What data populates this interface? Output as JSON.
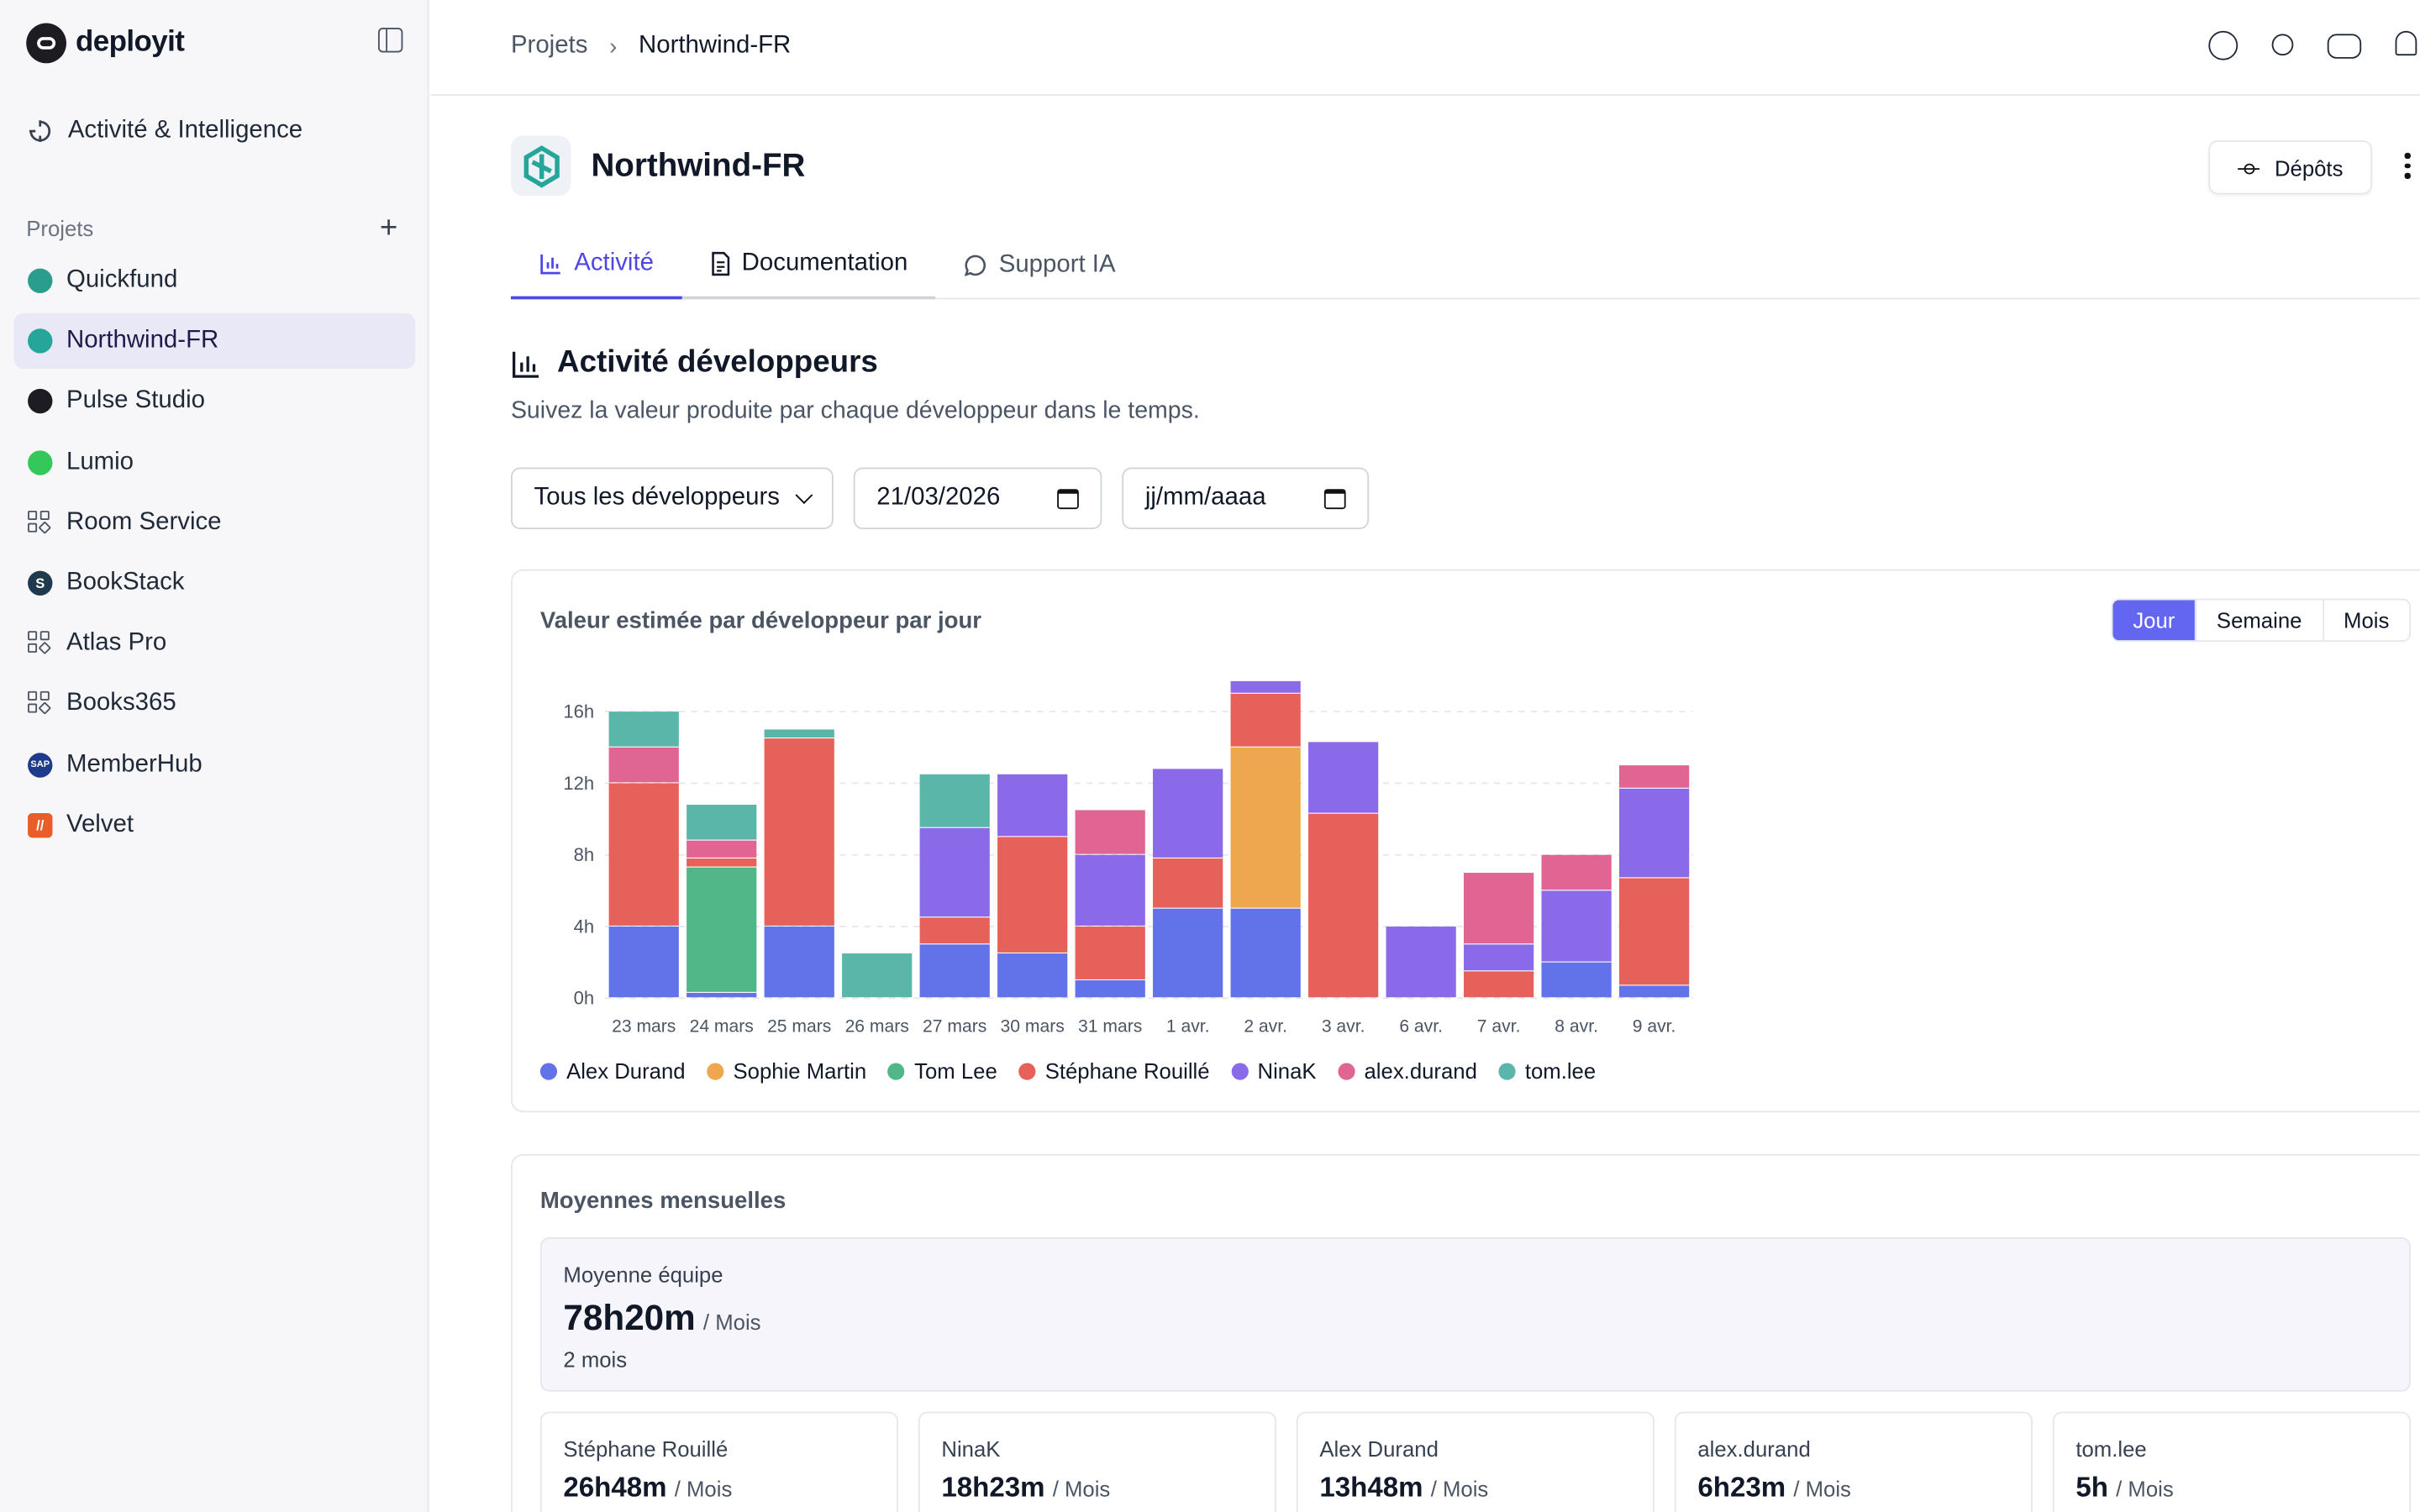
{
  "brand": {
    "name": "deployit"
  },
  "sidebar": {
    "main_item": "Activité & Intelligence",
    "section_label": "Projets",
    "projects": [
      {
        "label": "Quickfund",
        "icon": "quickfund-logo-icon",
        "color": "#2a9d8f"
      },
      {
        "label": "Northwind-FR",
        "icon": "northwind-logo-icon",
        "color": "#26a69a",
        "active": true
      },
      {
        "label": "Pulse Studio",
        "icon": "pulse-logo-icon",
        "color": "#1c1c22"
      },
      {
        "label": "Lumio",
        "icon": "lumio-logo-icon",
        "color": "#34c759"
      },
      {
        "label": "Room Service",
        "icon": "grid-icon",
        "color": "#4b5563"
      },
      {
        "label": "BookStack",
        "icon": "bookstack-logo-icon",
        "color": "#1f3a4d",
        "glyph": "S"
      },
      {
        "label": "Atlas Pro",
        "icon": "grid-icon",
        "color": "#4b5563"
      },
      {
        "label": "Books365",
        "icon": "grid-icon",
        "color": "#4b5563"
      },
      {
        "label": "MemberHub",
        "icon": "sap-logo-icon",
        "color": "#1e3a8a",
        "glyph": "SAP"
      },
      {
        "label": "Velvet",
        "icon": "velvet-logo-icon",
        "color": "#e85d2a",
        "glyph": "//"
      }
    ]
  },
  "breadcrumb": {
    "parent": "Projets",
    "separator": "›",
    "current": "Northwind-FR"
  },
  "header": {
    "title": "Northwind-FR",
    "depots_label": "Dépôts"
  },
  "tabs": [
    {
      "label": "Activité",
      "icon": "bar-chart-icon"
    },
    {
      "label": "Documentation",
      "icon": "document-icon"
    },
    {
      "label": "Support IA",
      "icon": "chat-icon"
    }
  ],
  "section": {
    "title": "Activité développeurs",
    "subtitle": "Suivez la valeur produite par chaque développeur dans le temps."
  },
  "filters": {
    "developer_select": "Tous les développeurs",
    "start_date": "21/03/2026",
    "end_date": "jj/mm/aaaa"
  },
  "chart_card": {
    "title": "Valeur estimée par développeur par jour",
    "ranges": [
      "Jour",
      "Semaine",
      "Mois"
    ],
    "selected_range": "Jour"
  },
  "chart_data": {
    "type": "bar",
    "stacked": true,
    "categories": [
      "23 mars",
      "24 mars",
      "25 mars",
      "26 mars",
      "27 mars",
      "30 mars",
      "31 mars",
      "1 avr.",
      "2 avr.",
      "3 avr.",
      "6 avr.",
      "7 avr.",
      "8 avr.",
      "9 avr."
    ],
    "y_ticks": [
      "0h",
      "4h",
      "8h",
      "12h",
      "16h"
    ],
    "ylim": [
      0,
      18
    ],
    "grid": true,
    "legend_position": "bottom-left",
    "series": [
      {
        "name": "Alex Durand",
        "color": "#6272e8",
        "values": [
          4,
          0.3,
          4,
          0,
          3,
          2.5,
          1,
          5,
          5,
          0,
          0,
          0,
          2,
          0.7
        ]
      },
      {
        "name": "Sophie Martin",
        "color": "#eea74e",
        "values": [
          0,
          0,
          0,
          0,
          0,
          0,
          0,
          0,
          9,
          0,
          0,
          0,
          0,
          0
        ]
      },
      {
        "name": "Tom Lee",
        "color": "#52b788",
        "values": [
          0,
          7,
          0,
          0,
          0,
          0,
          0,
          0,
          0,
          0,
          0,
          0,
          0,
          0
        ]
      },
      {
        "name": "Stéphane Rouillé",
        "color": "#e5615a",
        "values": [
          8,
          0.5,
          10.5,
          0,
          1.5,
          6.5,
          3,
          2.8,
          3,
          10.3,
          0,
          1.5,
          0,
          6
        ]
      },
      {
        "name": "NinaK",
        "color": "#8b6ae9",
        "values": [
          0,
          0,
          0,
          0,
          5,
          3.5,
          4,
          5,
          0.7,
          4,
          4,
          1.5,
          4,
          5
        ]
      },
      {
        "name": "alex.durand",
        "color": "#e06592",
        "values": [
          2,
          1,
          0,
          0,
          0,
          0,
          2.5,
          0,
          0,
          0,
          0,
          4,
          2,
          1.3
        ]
      },
      {
        "name": "tom.lee",
        "color": "#5ab6a8",
        "values": [
          2,
          2,
          0.5,
          2.5,
          3,
          0,
          0,
          0,
          0,
          0,
          0,
          0,
          0,
          0
        ]
      }
    ]
  },
  "averages": {
    "title": "Moyennes mensuelles",
    "team": {
      "label": "Moyenne équipe",
      "value": "78h20m",
      "unit": "/ Mois",
      "sub": "2 mois"
    },
    "developers": [
      {
        "name": "Stéphane Rouillé",
        "value": "26h48m",
        "unit": "/ Mois"
      },
      {
        "name": "NinaK",
        "value": "18h23m",
        "unit": "/ Mois"
      },
      {
        "name": "Alex Durand",
        "value": "13h48m",
        "unit": "/ Mois"
      },
      {
        "name": "alex.durand",
        "value": "6h23m",
        "unit": "/ Mois"
      },
      {
        "name": "tom.lee",
        "value": "5h",
        "unit": "/ Mois"
      }
    ]
  }
}
